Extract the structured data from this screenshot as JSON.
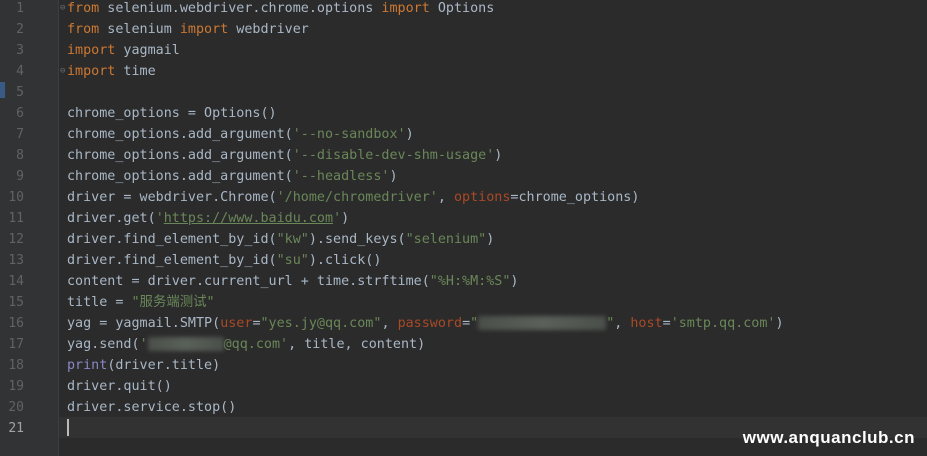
{
  "editor": {
    "language": "python",
    "current_line": 21,
    "line_numbers": [
      "1",
      "2",
      "3",
      "4",
      "5",
      "6",
      "7",
      "8",
      "9",
      "10",
      "11",
      "12",
      "13",
      "14",
      "15",
      "16",
      "17",
      "18",
      "19",
      "20",
      "21"
    ]
  },
  "code": {
    "l1": [
      {
        "t": "from",
        "c": "kw"
      },
      {
        "t": " selenium.webdriver.chrome.options ",
        "c": ""
      },
      {
        "t": "import",
        "c": "kw"
      },
      {
        "t": " Options",
        "c": ""
      }
    ],
    "l2": [
      {
        "t": "from",
        "c": "kw"
      },
      {
        "t": " selenium ",
        "c": ""
      },
      {
        "t": "import",
        "c": "kw"
      },
      {
        "t": " webdriver",
        "c": ""
      }
    ],
    "l3": [
      {
        "t": "import",
        "c": "kw"
      },
      {
        "t": " yagmail",
        "c": ""
      }
    ],
    "l4": [
      {
        "t": "import",
        "c": "kw"
      },
      {
        "t": " time",
        "c": ""
      }
    ],
    "l5": [],
    "l6": [
      {
        "t": "chrome_options = Options()",
        "c": ""
      }
    ],
    "l7": [
      {
        "t": "chrome_options.add_argument(",
        "c": ""
      },
      {
        "t": "'--no-sandbox'",
        "c": "str"
      },
      {
        "t": ")",
        "c": ""
      }
    ],
    "l8": [
      {
        "t": "chrome_options.add_argument(",
        "c": ""
      },
      {
        "t": "'--disable-dev-shm-usage'",
        "c": "str"
      },
      {
        "t": ")",
        "c": ""
      }
    ],
    "l9": [
      {
        "t": "chrome_options.add_argument(",
        "c": ""
      },
      {
        "t": "'--headless'",
        "c": "str"
      },
      {
        "t": ")",
        "c": ""
      }
    ],
    "l10": [
      {
        "t": "driver = webdriver.Chrome(",
        "c": ""
      },
      {
        "t": "'/home/chromedriver'",
        "c": "str"
      },
      {
        "t": ", ",
        "c": ""
      },
      {
        "t": "options",
        "c": "param"
      },
      {
        "t": "=chrome_options)",
        "c": ""
      }
    ],
    "l11": [
      {
        "t": "driver.get(",
        "c": ""
      },
      {
        "t": "'",
        "c": "str"
      },
      {
        "t": "https://www.baidu.com",
        "c": "link"
      },
      {
        "t": "'",
        "c": "str"
      },
      {
        "t": ")",
        "c": ""
      }
    ],
    "l12": [
      {
        "t": "driver.find_element_by_id(",
        "c": ""
      },
      {
        "t": "\"kw\"",
        "c": "str"
      },
      {
        "t": ").send_keys(",
        "c": ""
      },
      {
        "t": "\"selenium\"",
        "c": "str"
      },
      {
        "t": ")",
        "c": ""
      }
    ],
    "l13": [
      {
        "t": "driver.find_element_by_id(",
        "c": ""
      },
      {
        "t": "\"su\"",
        "c": "str"
      },
      {
        "t": ").click()",
        "c": ""
      }
    ],
    "l14": [
      {
        "t": "content = driver.current_url + time.strftime(",
        "c": ""
      },
      {
        "t": "\"%H:%M:%S\"",
        "c": "str"
      },
      {
        "t": ")",
        "c": ""
      }
    ],
    "l15": [
      {
        "t": "title = ",
        "c": ""
      },
      {
        "t": "\"服务端测试\"",
        "c": "str"
      }
    ],
    "l16": [
      {
        "t": "yag = yagmail.SMTP(",
        "c": ""
      },
      {
        "t": "user",
        "c": "param"
      },
      {
        "t": "=",
        "c": ""
      },
      {
        "t": "\"yes.jy@qq.com\"",
        "c": "str"
      },
      {
        "t": ", ",
        "c": ""
      },
      {
        "t": "password",
        "c": "param"
      },
      {
        "t": "=",
        "c": ""
      },
      {
        "t": "\"",
        "c": "str"
      },
      {
        "t": "",
        "c": "blur",
        "w": 128
      },
      {
        "t": "\"",
        "c": "str"
      },
      {
        "t": ", ",
        "c": ""
      },
      {
        "t": "host",
        "c": "param"
      },
      {
        "t": "=",
        "c": ""
      },
      {
        "t": "'smtp.qq.com'",
        "c": "str"
      },
      {
        "t": ")",
        "c": ""
      }
    ],
    "l17": [
      {
        "t": "yag.send(",
        "c": ""
      },
      {
        "t": "'",
        "c": "str"
      },
      {
        "t": "",
        "c": "blur",
        "w": 76
      },
      {
        "t": "@qq.com'",
        "c": "str"
      },
      {
        "t": ", title, content)",
        "c": ""
      }
    ],
    "l18": [
      {
        "t": "print",
        "c": "builtin"
      },
      {
        "t": "(driver.title)",
        "c": ""
      }
    ],
    "l19": [
      {
        "t": "driver.quit()",
        "c": ""
      }
    ],
    "l20": [
      {
        "t": "driver.service.stop()",
        "c": ""
      }
    ],
    "l21": []
  },
  "watermark": {
    "text": "www.anquanclub.cn"
  },
  "colors": {
    "background": "#2b2b2b",
    "gutter": "#313335",
    "keyword": "#cc7832",
    "string": "#6a8759",
    "param": "#aa4926",
    "builtin": "#8888c6",
    "default": "#a9b7c6"
  }
}
